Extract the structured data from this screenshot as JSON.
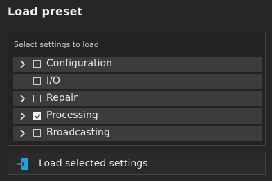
{
  "dialog": {
    "title": "Load preset"
  },
  "panel": {
    "label": "Select settings to load",
    "items": [
      {
        "label": "Configuration",
        "expandable": true,
        "checked": false
      },
      {
        "label": "I/O",
        "expandable": false,
        "checked": false
      },
      {
        "label": "Repair",
        "expandable": true,
        "checked": false
      },
      {
        "label": "Processing",
        "expandable": true,
        "checked": true
      },
      {
        "label": "Broadcasting",
        "expandable": true,
        "checked": false
      }
    ]
  },
  "load_button": {
    "label": "Load selected settings",
    "icon": "import-icon",
    "icon_color": "#1aa3e8"
  }
}
